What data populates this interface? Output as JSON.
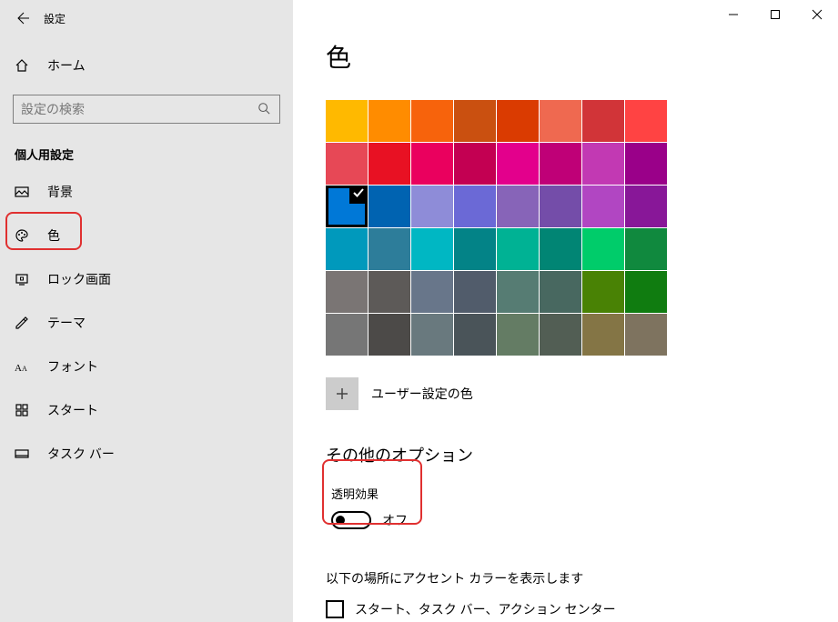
{
  "titlebar": {
    "title": "設定"
  },
  "home": {
    "label": "ホーム"
  },
  "search": {
    "placeholder": "設定の検索"
  },
  "section_header": "個人用設定",
  "nav": [
    {
      "label": "背景"
    },
    {
      "label": "色"
    },
    {
      "label": "ロック画面"
    },
    {
      "label": "テーマ"
    },
    {
      "label": "フォント"
    },
    {
      "label": "スタート"
    },
    {
      "label": "タスク バー"
    }
  ],
  "page_title": "色",
  "swatches": [
    "#ffb900",
    "#ff8c00",
    "#f7630c",
    "#ca5010",
    "#da3b01",
    "#ef6950",
    "#d13438",
    "#ff4343",
    "#e74856",
    "#e81123",
    "#ea005e",
    "#c30052",
    "#e3008c",
    "#bf0077",
    "#c239b3",
    "#9a0089",
    "#0078d7",
    "#0063b1",
    "#8e8cd8",
    "#6b69d6",
    "#8764b8",
    "#744da9",
    "#b146c2",
    "#881798",
    "#0099bc",
    "#2d7d9a",
    "#00b7c3",
    "#038387",
    "#00b294",
    "#018574",
    "#00cc6a",
    "#10893e",
    "#7a7574",
    "#5d5a58",
    "#68768a",
    "#515c6b",
    "#567c73",
    "#486860",
    "#498205",
    "#107c10",
    "#767676",
    "#4c4a48",
    "#69797e",
    "#4a5459",
    "#647c64",
    "#525e54",
    "#847545",
    "#7e735f"
  ],
  "selected_index": 16,
  "custom_color": {
    "label": "ユーザー設定の色"
  },
  "options_header": "その他のオプション",
  "transparency": {
    "label": "透明効果",
    "state": "オフ"
  },
  "accent_desc": "以下の場所にアクセント カラーを表示します",
  "checkbox1": {
    "label": "スタート、タスク バー、アクション センター"
  }
}
